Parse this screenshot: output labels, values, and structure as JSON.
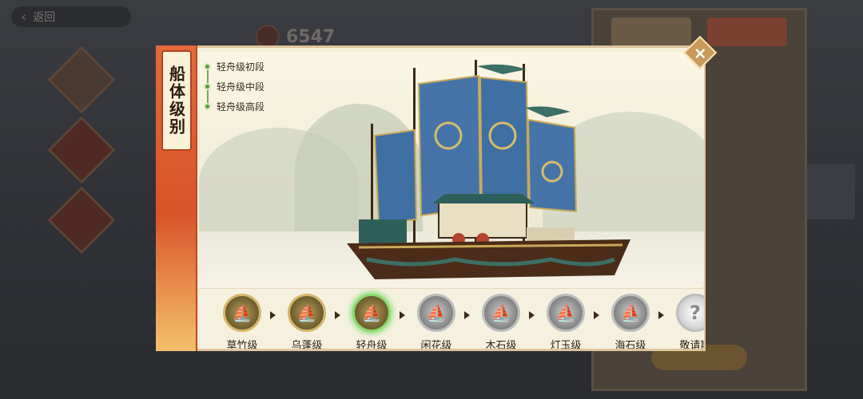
{
  "background": {
    "back_label": "返回",
    "coin_amount": "6547"
  },
  "panel": {
    "side_title": "船体级别",
    "stages": [
      "轻舟级初段",
      "轻舟级中段",
      "轻舟级高段"
    ],
    "close_icon": "×"
  },
  "tiers": [
    {
      "label": "草竹级",
      "icon": "ship-tier-icon",
      "state": "unlocked"
    },
    {
      "label": "乌蓬级",
      "icon": "ship-tier-icon",
      "state": "unlocked"
    },
    {
      "label": "轻舟级",
      "icon": "ship-tier-icon",
      "state": "selected"
    },
    {
      "label": "闲花级",
      "icon": "ship-tier-icon",
      "state": "locked"
    },
    {
      "label": "木石级",
      "icon": "ship-tier-icon",
      "state": "locked"
    },
    {
      "label": "灯玉级",
      "icon": "ship-tier-icon",
      "state": "locked"
    },
    {
      "label": "海石级",
      "icon": "ship-tier-icon",
      "state": "locked"
    },
    {
      "label": "敬请期",
      "icon": "question-icon",
      "state": "mystery",
      "symbol": "?"
    }
  ],
  "colors": {
    "accent": "#d9532a",
    "selected_glow": "#88d96c",
    "sail_blue": "#3f6fa3"
  }
}
